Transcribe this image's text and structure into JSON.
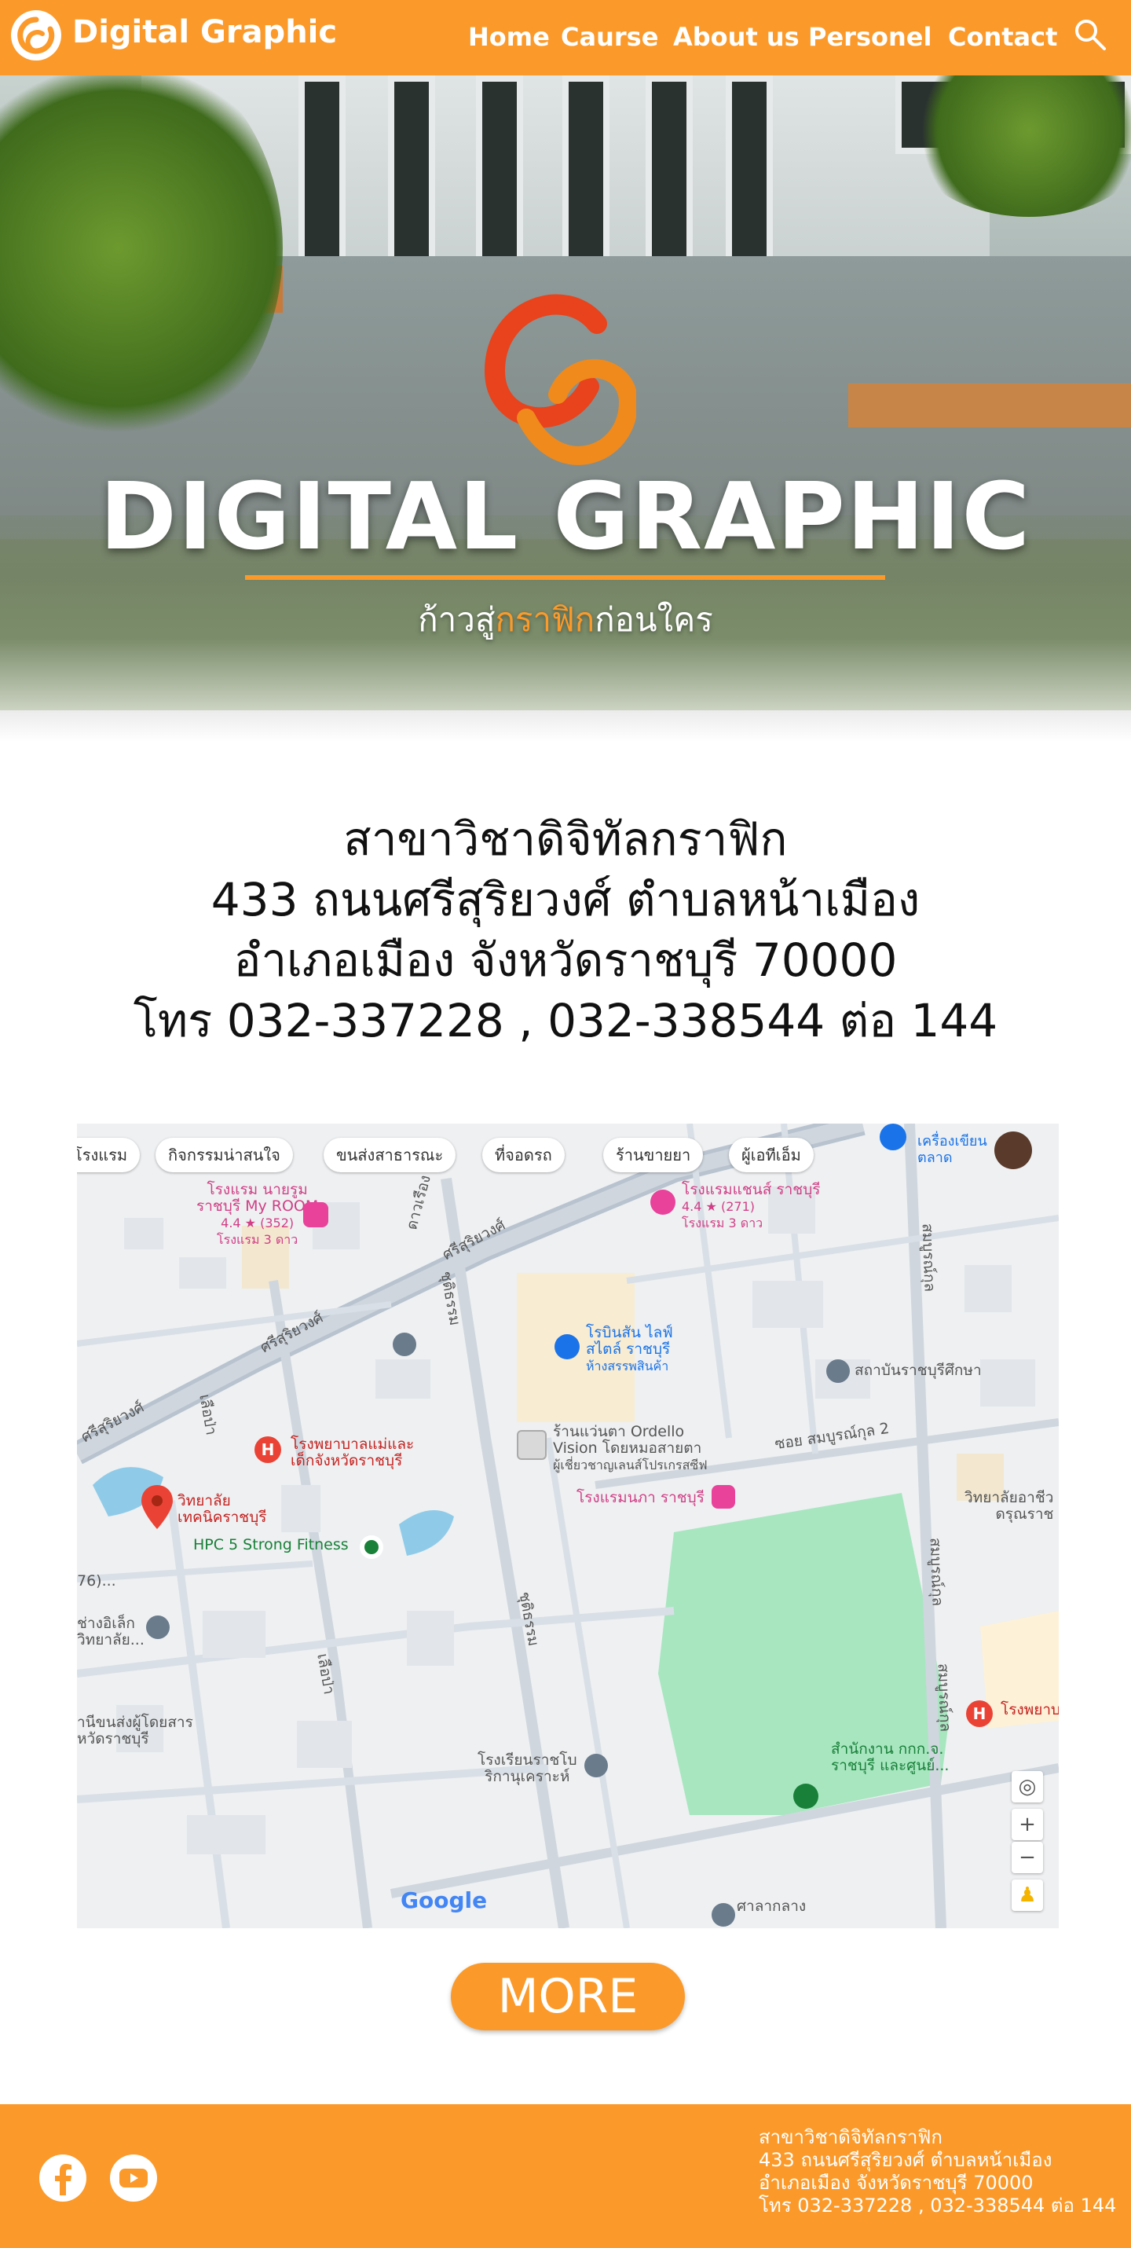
{
  "nav": {
    "brand": "Digital Graphic",
    "items": [
      {
        "label": "Home"
      },
      {
        "label": "Caurse"
      },
      {
        "label": "About us"
      },
      {
        "label": "Personel"
      },
      {
        "label": "Contact"
      }
    ]
  },
  "hero": {
    "title": "DIGITAL GRAPHIC",
    "subtitle_before": "ก้าวสู่",
    "subtitle_highlight": "กราฟิก",
    "subtitle_after": "ก่อนใคร"
  },
  "address": {
    "line1": "สาขาวิชาดิจิทัลกราฟิก",
    "line2": "433 ถนนศรีสุริยวงศ์ ตำบลหน้าเมือง",
    "line3": "อำเภอเมือง จังหวัดราชบุรี 70000",
    "line4": "โทร 032-337228 , 032-338544 ต่อ 144"
  },
  "map": {
    "chips": [
      "โรงแรม",
      "กิจกรรมน่าสนใจ",
      "ขนส่งสาธารณะ",
      "ที่จอดรถ",
      "ร้านขายยา",
      "ผู้เอทีเอ็ม"
    ],
    "places": {
      "hotel_myroom": "โรงแรม นายรูม",
      "hotel_myroom2": "ราชบุรี My ROOM",
      "hotel_myroom_rating": "4.4 ★ (352)",
      "hotel_myroom_type": "โรงแรม 3 ดาว",
      "hotel_chance": "โรงแรมแชนส์ ราชบุรี",
      "hotel_chance_rating": "4.4 ★ (271)",
      "hotel_chance_type": "โรงแรม 3 ดาว",
      "robinson": "โรบินสัน ไลฟ์",
      "robinson2": "สไตล์ ราชบุรี",
      "robinson_type": "ห้างสรรพสินค้า",
      "institute": "สถาบันราชบุรีศึกษา",
      "optical": "ร้านแว่นตา Ordello",
      "optical2": "Vision โดยหมอสายตา",
      "optical3": "ผู้เชี่ยวชาญเลนส์โปรเกรสซีฟ",
      "hospital_mother": "โรงพยาบาลแม่และ",
      "hospital_mother2": "เด็กจังหวัดราชบุรี",
      "college": "วิทยาลัย",
      "college2": "เทคนิคราชบุรี",
      "hotel_nanpha": "โรงแรมนภา ราชบุรี",
      "fitness": "HPC 5 Strong Fitness",
      "school_right": "วิทยาลัยอาชีว",
      "school_right2": "ดรุณราช",
      "left1": "76)...",
      "left2": "ช่างอิเล็ก",
      "left3": "วิทยาลัย...",
      "left4": "านีขนส่งผู้โดยสาร",
      "left5": "หวัดราชบุรี",
      "hospital_right": "โรงพยาบ",
      "office": "สำนักงาน กกก.จ.",
      "office2": "ราชบุรี และศูนย์...",
      "school_bottom": "โรงเรียนราชโบ",
      "school_bottom2": "ริกานุเคราะห์",
      "court": "ศาลากลาง",
      "market_top": "เครื่องเขียน",
      "market_top2": "ตลาด",
      "road_srisuriyawong": "ศรีสุริยวงศ์",
      "road_srisuriyawong2": "ศรีสุริยวงศ์",
      "road_srisuriyawong3": "ศรีสุริยวงศ์",
      "road_khao": "ดาวเรือง",
      "road_chaidharma": "ชุติธรรม",
      "road_chaidharma2": "ชุติธรรม",
      "road_leuapa": "เลือป่า",
      "road_leuapa2": "เลือป่า",
      "road_somboonkul": "สมบูรณ์กุล",
      "road_somboonkul2": "สมบูรณ์กุล",
      "road_somboonkul3": "สมบูรณ์กุล",
      "soi": "ซอย สมบูรณ์กุล 2"
    },
    "google": "Google"
  },
  "more_label": "MORE",
  "footer": {
    "line1": "สาขาวิชาดิจิทัลกราฟิก",
    "line2": "433 ถนนศรีสุริยวงศ์ ตำบลหน้าเมือง",
    "line3": "อำเภอเมือง จังหวัดราชบุรี 70000",
    "line4": "โทร 032-337228 , 032-338544 ต่อ 144"
  },
  "icons": [
    "logo-icon",
    "search-icon",
    "facebook-icon",
    "youtube-icon",
    "map-pin-icon"
  ],
  "colors": {
    "accent": "#fb9a2a",
    "map_park": "#a8e6c0",
    "map_water": "#8fcbe8"
  }
}
